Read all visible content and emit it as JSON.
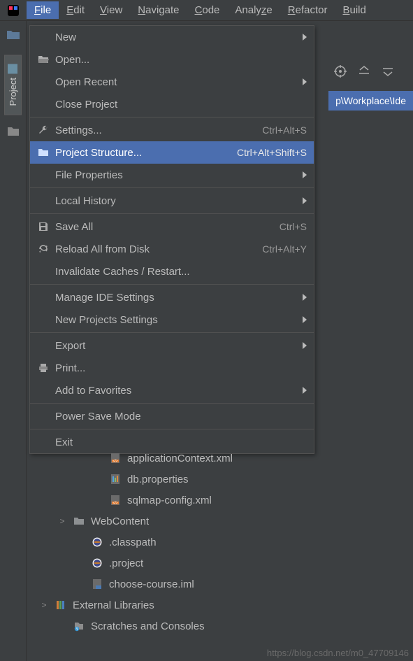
{
  "menubar": {
    "items": [
      "File",
      "Edit",
      "View",
      "Navigate",
      "Code",
      "Analyze",
      "Refactor",
      "Build"
    ],
    "underlines": [
      "F",
      "E",
      "V",
      "N",
      "C",
      "z",
      "R",
      "B"
    ],
    "active_index": 0
  },
  "sidebar": {
    "tab_label": "Project"
  },
  "breadcrumb": {
    "visible_fragment": "p\\Workplace\\Ide"
  },
  "file_menu": {
    "items": [
      {
        "type": "item",
        "icon": "",
        "label": "New",
        "submenu": true
      },
      {
        "type": "item",
        "icon": "folder-open",
        "label": "Open...",
        "submenu": false
      },
      {
        "type": "item",
        "icon": "",
        "label": "Open Recent",
        "submenu": true
      },
      {
        "type": "item",
        "icon": "",
        "label": "Close Project",
        "submenu": false
      },
      {
        "type": "sep"
      },
      {
        "type": "item",
        "icon": "wrench",
        "label": "Settings...",
        "shortcut": "Ctrl+Alt+S"
      },
      {
        "type": "item",
        "icon": "folder",
        "label": "Project Structure...",
        "shortcut": "Ctrl+Alt+Shift+S",
        "selected": true
      },
      {
        "type": "item",
        "icon": "",
        "label": "File Properties",
        "submenu": true
      },
      {
        "type": "sep"
      },
      {
        "type": "item",
        "icon": "",
        "label": "Local History",
        "submenu": true
      },
      {
        "type": "sep"
      },
      {
        "type": "item",
        "icon": "save",
        "label": "Save All",
        "shortcut": "Ctrl+S"
      },
      {
        "type": "item",
        "icon": "reload",
        "label": "Reload All from Disk",
        "shortcut": "Ctrl+Alt+Y"
      },
      {
        "type": "item",
        "icon": "",
        "label": "Invalidate Caches / Restart..."
      },
      {
        "type": "sep"
      },
      {
        "type": "item",
        "icon": "",
        "label": "Manage IDE Settings",
        "submenu": true
      },
      {
        "type": "item",
        "icon": "",
        "label": "New Projects Settings",
        "submenu": true
      },
      {
        "type": "sep"
      },
      {
        "type": "item",
        "icon": "",
        "label": "Export",
        "submenu": true
      },
      {
        "type": "item",
        "icon": "print",
        "label": "Print..."
      },
      {
        "type": "item",
        "icon": "",
        "label": "Add to Favorites",
        "submenu": true
      },
      {
        "type": "sep"
      },
      {
        "type": "item",
        "icon": "",
        "label": "Power Save Mode"
      },
      {
        "type": "sep"
      },
      {
        "type": "item",
        "icon": "",
        "label": "Exit"
      }
    ]
  },
  "tree": {
    "rows": [
      {
        "indent": 3,
        "icon": "xml",
        "label": "applicationContext.xml"
      },
      {
        "indent": 3,
        "icon": "props",
        "label": "db.properties"
      },
      {
        "indent": 3,
        "icon": "xml",
        "label": "sqlmap-config.xml"
      },
      {
        "indent": 1,
        "expander": ">",
        "icon": "dir",
        "label": "WebContent"
      },
      {
        "indent": 2,
        "icon": "eclipse",
        "label": ".classpath"
      },
      {
        "indent": 2,
        "icon": "eclipse",
        "label": ".project"
      },
      {
        "indent": 2,
        "icon": "iml",
        "label": "choose-course.iml"
      },
      {
        "indent": 0,
        "expander": ">",
        "icon": "libs",
        "label": "External Libraries"
      },
      {
        "indent": 1,
        "icon": "scratch",
        "label": "Scratches and Consoles"
      }
    ]
  },
  "watermark": "https://blog.csdn.net/m0_47709146"
}
